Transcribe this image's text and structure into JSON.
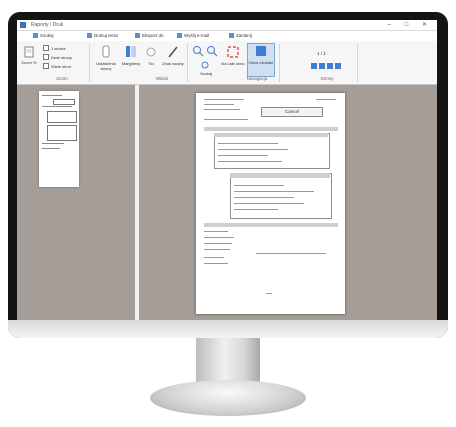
{
  "window": {
    "title": "Raporty / Druk"
  },
  "quick_toolbar": {
    "items": [
      "Szukaj",
      "Drukuj teraz",
      "Eksport do",
      "Wyślij e-mail",
      "Zamknij"
    ]
  },
  "ribbon": {
    "zoom_group": {
      "label": "Zoom",
      "fit_label": "Zoom %",
      "options": [
        "1 strona",
        "Dwie strony",
        "Wiele stron"
      ]
    },
    "view_group": {
      "label": "Widok",
      "buttons": [
        "Ustawienia strony",
        "Marginesy",
        "Tło",
        "Znak wodny"
      ]
    },
    "navigation_group": {
      "label": "Nawigacja",
      "buttons": [
        "Szukaj",
        "Na całe okno",
        "Okno miniatur"
      ]
    },
    "pages_group": {
      "label": "Strony",
      "page_readout": "1 / 1"
    }
  },
  "document": {
    "cancel_label": "Cancel"
  }
}
